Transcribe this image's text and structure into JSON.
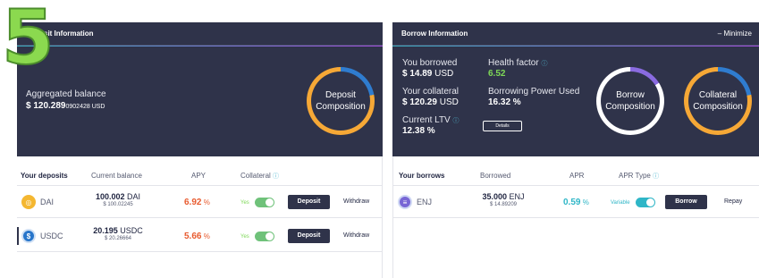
{
  "step_number": "5",
  "deposit_panel": {
    "title": "Deposit Information",
    "aggregated_label": "Aggregated balance",
    "aggregated_main": "$ 120.289",
    "aggregated_small": "0902428",
    "aggregated_unit": " USD",
    "donut_label_1": "Deposit",
    "donut_label_2": "Composition"
  },
  "borrow_panel": {
    "title": "Borrow Information",
    "minimize_label": "– Minimize",
    "you_borrowed_label": "You borrowed",
    "you_borrowed_value": "$ 14.89",
    "you_borrowed_unit": " USD",
    "health_factor_label": "Health factor",
    "health_factor_value": "6.52",
    "your_collateral_label": "Your collateral",
    "your_collateral_value": "$ 120.29",
    "your_collateral_unit": " USD",
    "borrowing_power_label": "Borrowing Power Used",
    "borrowing_power_value": "16.32 %",
    "current_ltv_label": "Current LTV",
    "current_ltv_value": "12.38 %",
    "details_label": "Details",
    "borrow_donut_1": "Borrow",
    "borrow_donut_2": "Composition",
    "collateral_donut_1": "Collateral",
    "collateral_donut_2": "Composition",
    "info_icon": "ⓘ"
  },
  "deposits_table": {
    "headers": [
      "Your deposits",
      "Current balance",
      "APY",
      "Collateral"
    ],
    "rows": [
      {
        "asset": "DAI",
        "balance": "100.002",
        "balance_unit": " DAI",
        "balance_usd": "$ 100.02245",
        "apy": "6.92",
        "apy_unit": " %",
        "collateral": "Yes",
        "deposit_label": "Deposit",
        "withdraw_label": "Withdraw"
      },
      {
        "asset": "USDC",
        "balance": "20.195",
        "balance_unit": " USDC",
        "balance_usd": "$ 20.26664",
        "apy": "5.66",
        "apy_unit": " %",
        "collateral": "Yes",
        "deposit_label": "Deposit",
        "withdraw_label": "Withdraw"
      }
    ]
  },
  "borrows_table": {
    "headers": [
      "Your borrows",
      "Borrowed",
      "APR",
      "APR Type"
    ],
    "rows": [
      {
        "asset": "ENJ",
        "borrowed": "35.000",
        "borrowed_unit": " ENJ",
        "borrowed_usd": "$ 14.89209",
        "apr": "0.59",
        "apr_unit": " %",
        "apr_type": "Variable",
        "borrow_label": "Borrow",
        "repay_label": "Repay"
      }
    ]
  },
  "colors": {
    "panel_bg": "#2f334a",
    "apy_deposit": "#e85a2e",
    "apr_borrow": "#2fb6c7",
    "health_green": "#7ed957",
    "donut_orange": "#f6a836",
    "donut_blue": "#2f7ccf"
  }
}
